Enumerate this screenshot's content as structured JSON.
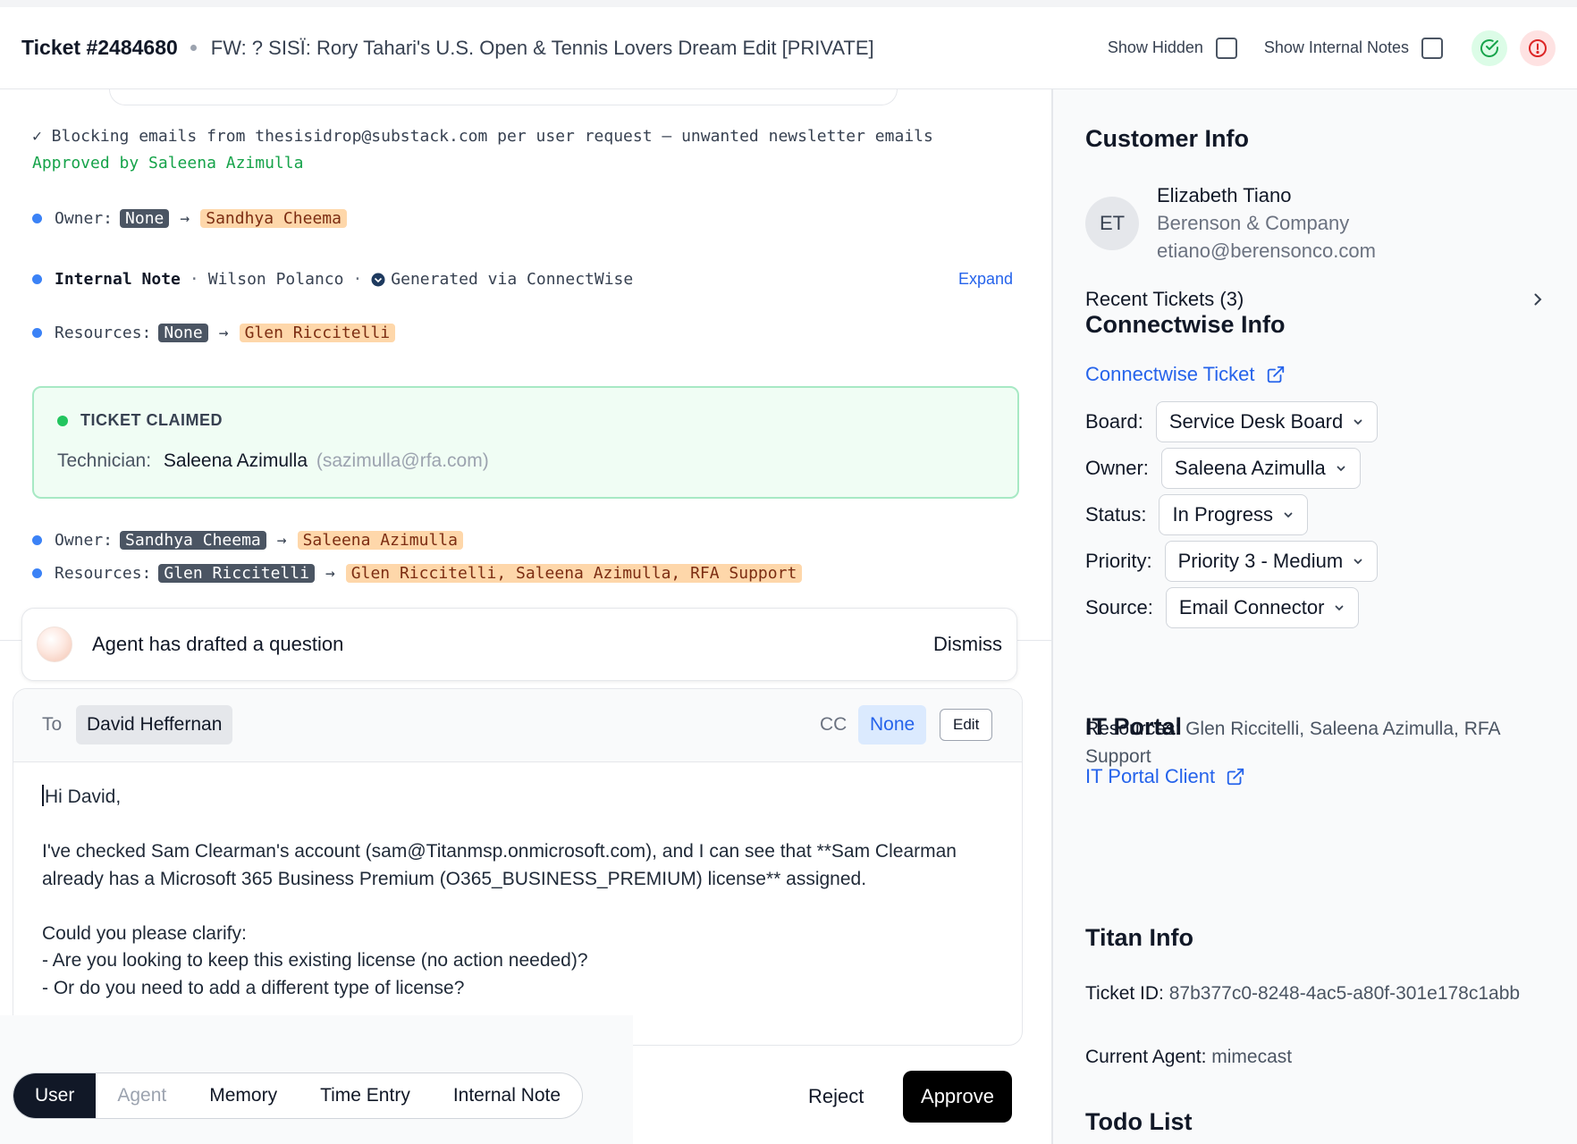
{
  "header": {
    "ticket_number": "Ticket #2484680",
    "subject": "FW: ? SISÏ: Rory Tahari's U.S. Open & Tennis Lovers Dream Edit [PRIVATE]",
    "show_hidden_label": "Show Hidden",
    "show_internal_notes_label": "Show Internal Notes",
    "colors": {
      "ok": "#16a34a",
      "alert": "#dc2626"
    }
  },
  "activity": {
    "blocking_note": "✓ Blocking emails from thesisidrop@substack.com per user request – unwanted newsletter emails",
    "approved_by": "Approved by Saleena Azimulla",
    "owner_change_1": {
      "label": "Owner:",
      "from": "None",
      "arrow": "→",
      "to": "Sandhya Cheema"
    },
    "internal_note": {
      "title": "Internal Note",
      "sep": "·",
      "author": "Wilson Polanco",
      "source": "Generated via ConnectWise",
      "expand": "Expand"
    },
    "resources_change_1": {
      "label": "Resources:",
      "from": "None",
      "arrow": "→",
      "to": "Glen Riccitelli"
    },
    "claimed": {
      "title": "TICKET CLAIMED",
      "technician_label": "Technician:",
      "technician_name": "Saleena Azimulla",
      "technician_email": "(sazimulla@rfa.com)"
    },
    "owner_change_2": {
      "label": "Owner:",
      "from": "Sandhya Cheema",
      "arrow": "→",
      "to": "Saleena Azimulla"
    },
    "resources_change_2": {
      "label": "Resources:",
      "from": "Glen Riccitelli",
      "arrow": "→",
      "to": "Glen Riccitelli, Saleena Azimulla, RFA Support"
    }
  },
  "draft": {
    "title": "Agent has drafted a question",
    "dismiss": "Dismiss"
  },
  "composer": {
    "to_label": "To",
    "to_value": "David Heffernan",
    "cc_label": "CC",
    "cc_value": "None",
    "edit_label": "Edit",
    "greeting": "Hi David,",
    "para1": "I've checked Sam Clearman's account (sam@Titanmsp.onmicrosoft.com), and I can see that **Sam Clearman already has a Microsoft 365 Business Premium (O365_BUSINESS_PREMIUM) license** assigned.",
    "para2_line1": "Could you please clarify:",
    "para2_line2": "- Are you looking to keep this existing license (no action needed)?",
    "para2_line3": "- Or do you need to add a different type of license?"
  },
  "tabs": [
    {
      "label": "User"
    },
    {
      "label": "Agent"
    },
    {
      "label": "Memory"
    },
    {
      "label": "Time Entry"
    },
    {
      "label": "Internal Note"
    }
  ],
  "actions": {
    "reject": "Reject",
    "approve": "Approve"
  },
  "sidebar": {
    "customer_info": {
      "heading": "Customer Info",
      "initials": "ET",
      "name": "Elizabeth Tiano",
      "company": "Berenson & Company",
      "email": "etiano@berensonco.com",
      "recent_tickets": "Recent Tickets (3)"
    },
    "connectwise": {
      "heading": "Connectwise Info",
      "ticket_link": "Connectwise Ticket",
      "board_label": "Board:",
      "board_value": "Service Desk Board",
      "owner_label": "Owner:",
      "owner_value": "Saleena Azimulla",
      "status_label": "Status:",
      "status_value": "In Progress",
      "priority_label": "Priority:",
      "priority_value": "Priority 3 - Medium",
      "source_label": "Source:",
      "source_value": "Email Connector",
      "resources_label": "Resources:",
      "resources_value": "Glen Riccitelli, Saleena Azimulla, RFA Support"
    },
    "it_portal": {
      "heading": "IT Portal",
      "link": "IT Portal Client"
    },
    "titan": {
      "heading": "Titan Info",
      "ticket_id_label": "Ticket ID:",
      "ticket_id_value": "87b377c0-8248-4ac5-a80f-301e178c1abb",
      "current_agent_label": "Current Agent:",
      "current_agent_value": "mimecast"
    },
    "todo": {
      "heading": "Todo List"
    }
  }
}
